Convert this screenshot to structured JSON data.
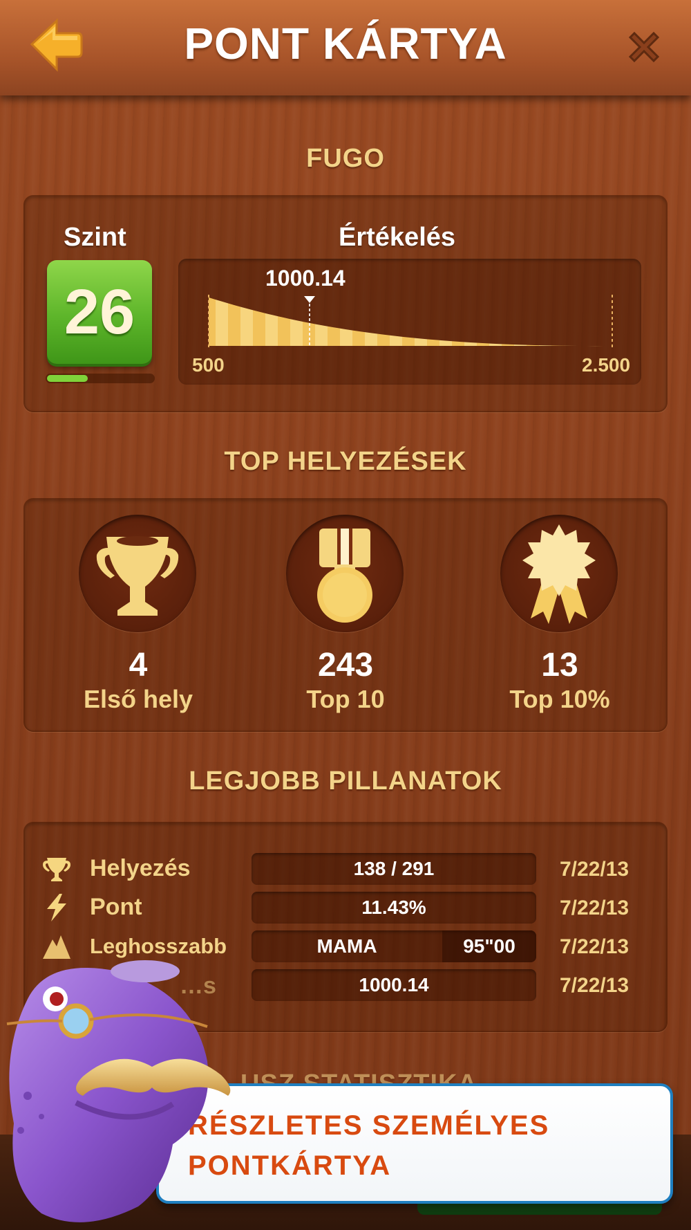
{
  "header": {
    "title": "PONT KÁRTYA"
  },
  "sections": {
    "player_name": "FUGO",
    "top_placements": "TOP HELYEZÉSEK",
    "best_moments": "LEGJOBB PILLANATOK",
    "hidden_section": "…USZ STATISZTIKA"
  },
  "level": {
    "label": "Szint",
    "value": "26",
    "progress": 0.38
  },
  "rating": {
    "label": "Értékelés",
    "value": "1000.14",
    "min": "500",
    "max": "2.500",
    "position_fraction": 0.25
  },
  "placements": [
    {
      "count": "4",
      "label": "Első hely",
      "icon": "trophy-icon"
    },
    {
      "count": "243",
      "label": "Top 10",
      "icon": "medal-icon"
    },
    {
      "count": "13",
      "label": "Top 10%",
      "icon": "award-ribbon-icon"
    }
  ],
  "best_moments": [
    {
      "icon": "trophy-icon",
      "label": "Helyezés",
      "value": "138 / 291",
      "date": "7/22/13"
    },
    {
      "icon": "lightning-icon",
      "label": "Pont",
      "value": "11.43%",
      "date": "7/22/13"
    },
    {
      "icon": "mountain-icon",
      "label": "Leghosszabb",
      "value": "MAMA",
      "value2": "95\"00",
      "date": "7/22/13"
    },
    {
      "icon": "rating-icon",
      "label": "…s",
      "value": "1000.14",
      "date": "7/22/13"
    }
  ],
  "banner": {
    "line1": "RÉSZLETES SZEMÉLYES",
    "line2": "PONTKÁRTYA"
  },
  "colors": {
    "accent_yellow": "#f3d48a",
    "level_green": "#5db52a",
    "banner_text": "#d84a10",
    "banner_border": "#1f7fc0"
  }
}
